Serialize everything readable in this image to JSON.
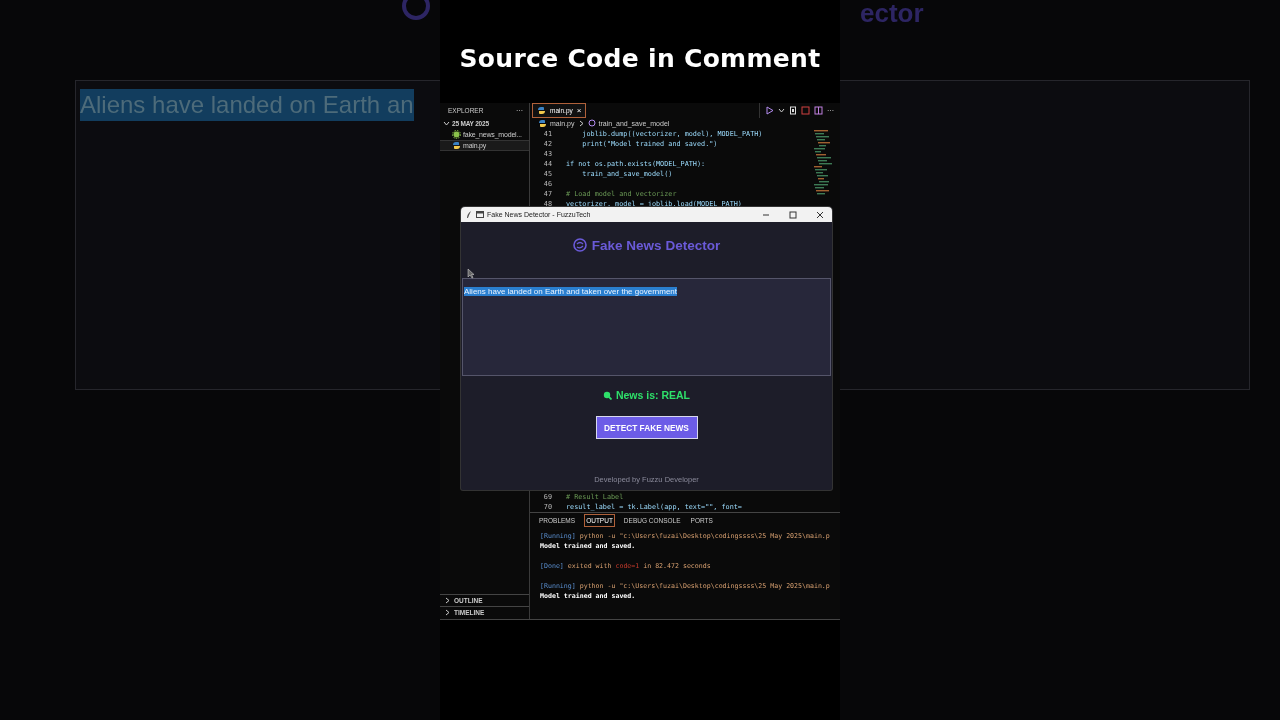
{
  "overlay_title": "Source Code in Comment",
  "backdrop": {
    "left_text": "Aliens have landed on Earth an",
    "left_selected": true,
    "right_text": "ector"
  },
  "vscode": {
    "explorer_title": "EXPLORER",
    "explorer_more": "···",
    "folder": {
      "label": "25 MAY 2025",
      "expanded": true,
      "children": [
        {
          "label": "fake_news_model...",
          "kind": "model",
          "selected": false
        },
        {
          "label": "main.py",
          "kind": "python",
          "selected": true
        }
      ]
    },
    "sections": [
      {
        "label": "OUTLINE",
        "expanded": false
      },
      {
        "label": "TIMELINE",
        "expanded": false
      }
    ],
    "tabs": [
      {
        "label": "main.py",
        "selected": true,
        "close": "×"
      }
    ],
    "toolbar_more": "···",
    "breadcrumb": [
      "main.py",
      "train_and_save_model"
    ],
    "code_top": [
      {
        "number": "41",
        "text": "    joblib.dump((vectorizer, model), MODEL_PATH)",
        "kind": "code"
      },
      {
        "number": "42",
        "text": "    print(\"Model trained and saved.\")",
        "kind": "code"
      },
      {
        "number": "43"
      },
      {
        "number": "44",
        "text": "if not os.path.exists(MODEL_PATH):",
        "kind": "code"
      },
      {
        "number": "45",
        "text": "    train_and_save_model()",
        "kind": "code"
      },
      {
        "number": "46"
      },
      {
        "number": "47",
        "text": "# Load model and vectorizer",
        "kind": "comment"
      },
      {
        "number": "48",
        "text": "vectorizer, model = joblib.load(MODEL_PATH)",
        "kind": "code"
      }
    ],
    "code_bottom": [
      {
        "number": "69",
        "text": "# Result Label",
        "kind": "comment"
      },
      {
        "number": "70",
        "text": "result_label = tk.Label(app, text=\"\", font=",
        "kind": "code"
      }
    ],
    "panel_tabs": [
      {
        "label": "PROBLEMS",
        "selected": false
      },
      {
        "label": "OUTPUT",
        "selected": true
      },
      {
        "label": "DEBUG CONSOLE",
        "selected": false
      },
      {
        "label": "PORTS",
        "selected": false
      }
    ],
    "output": [
      {
        "kind": "running",
        "parts": [
          {
            "kind": "tag",
            "text": "[Running]"
          },
          {
            "kind": "command",
            "text": " python -u \"c:\\Users\\fuzai\\Desktop\\codingssss\\25 May 2025\\main.p"
          }
        ]
      },
      {
        "kind": "plain",
        "parts": [
          {
            "kind": "bold",
            "text": "Model trained and saved."
          }
        ]
      },
      {
        "kind": "done",
        "parts": [
          {
            "kind": "tag",
            "text": "[Done]"
          },
          {
            "kind": "command",
            "text": " exited with "
          },
          {
            "kind": "error",
            "text": "code=1"
          },
          {
            "kind": "command",
            "text": " in 82.472 seconds"
          }
        ]
      },
      {
        "kind": "running",
        "parts": [
          {
            "kind": "tag",
            "text": "[Running]"
          },
          {
            "kind": "command",
            "text": " python -u \"c:\\Users\\fuzai\\Desktop\\codingssss\\25 May 2025\\main.p"
          }
        ]
      },
      {
        "kind": "plain",
        "parts": [
          {
            "kind": "bold",
            "text": "Model trained and saved."
          }
        ]
      }
    ]
  },
  "app_window": {
    "title": "Fake News Detector - FuzzuTech",
    "heading": "Fake News Detector",
    "input_text": "Aliens have landed on Earth and taken over the government",
    "input_selected": true,
    "result": "News is: REAL",
    "button": "DETECT FAKE NEWS",
    "footer": "Developed by Fuzzu Developer"
  }
}
